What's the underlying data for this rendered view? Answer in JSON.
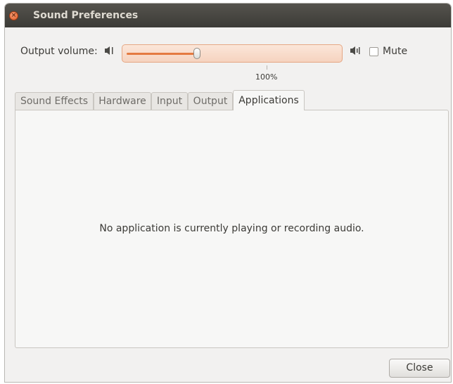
{
  "window": {
    "title": "Sound Preferences"
  },
  "volume": {
    "label": "Output volume:",
    "level_percent": 100,
    "level_fraction": 0.33,
    "tick_label": "100%",
    "low_icon": "speaker-low-icon",
    "high_icon": "speaker-high-icon",
    "mute_label": "Mute",
    "mute_checked": false
  },
  "tabs": [
    {
      "label": "Sound Effects",
      "active": false
    },
    {
      "label": "Hardware",
      "active": false
    },
    {
      "label": "Input",
      "active": false
    },
    {
      "label": "Output",
      "active": false
    },
    {
      "label": "Applications",
      "active": true
    }
  ],
  "applications": {
    "empty_message": "No application is currently playing or recording audio."
  },
  "footer": {
    "close_label": "Close"
  },
  "colors": {
    "accent": "#e47a41",
    "titlebar": "#3c3b37",
    "window_bg": "#f2f1f0"
  }
}
